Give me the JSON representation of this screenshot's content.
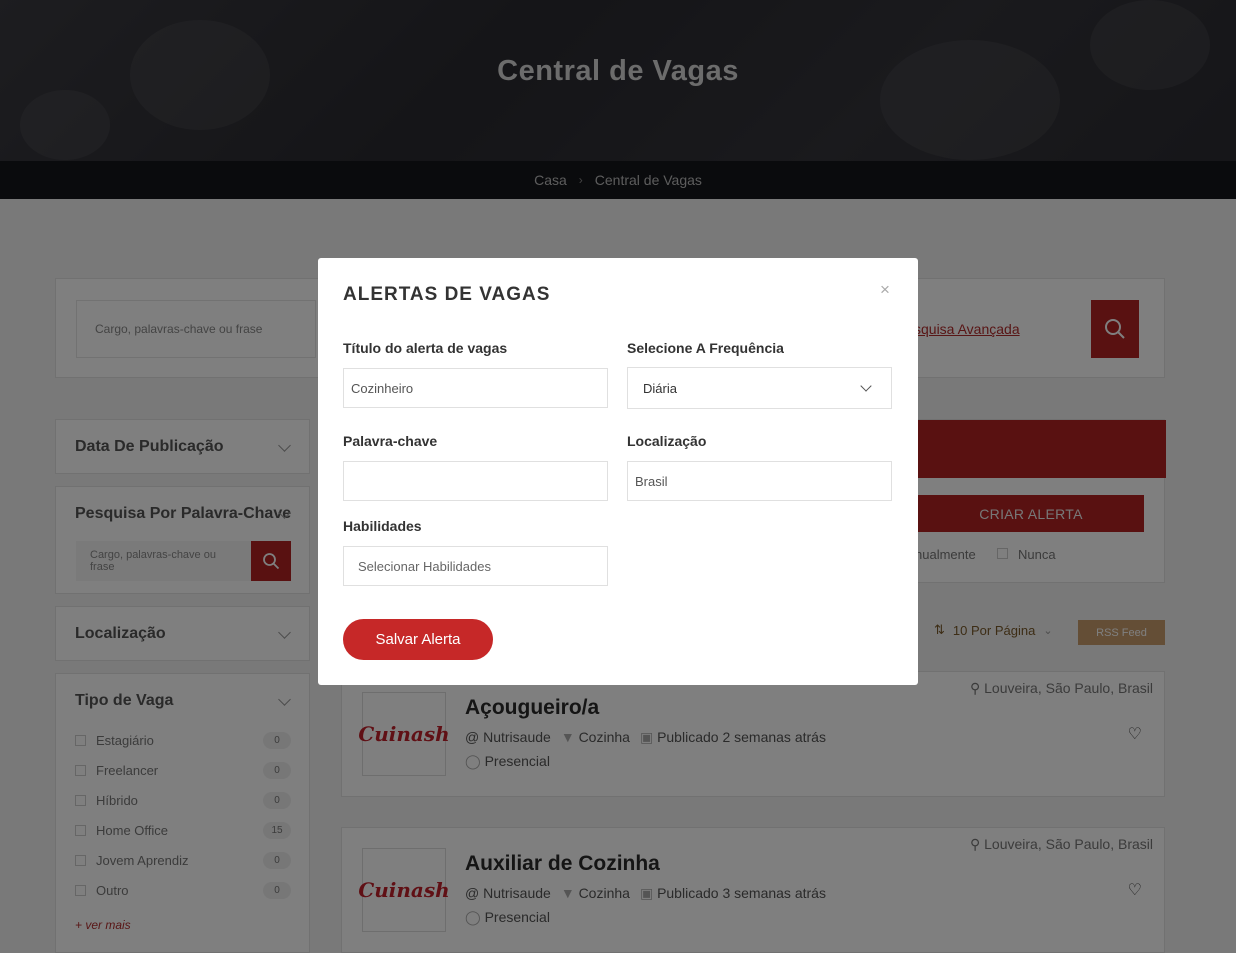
{
  "hero": {
    "title": "Central de Vagas"
  },
  "breadcrumb": {
    "items": [
      "Casa",
      "Central de Vagas"
    ]
  },
  "search": {
    "placeholder": "Cargo, palavras-chave ou frase",
    "advanced_link": "squisa Avançada"
  },
  "filters": {
    "date_title": "Data De Publicação",
    "keyword_title": "Pesquisa Por Palavra-Chave",
    "keyword_placeholder": "Cargo, palavras-chave ou frase",
    "location_title": "Localização",
    "type_title": "Tipo de Vaga",
    "types": [
      {
        "label": "Estagiário",
        "count": "0"
      },
      {
        "label": "Freelancer",
        "count": "0"
      },
      {
        "label": "Híbrido",
        "count": "0"
      },
      {
        "label": "Home Office",
        "count": "15"
      },
      {
        "label": "Jovem Aprendiz",
        "count": "0"
      },
      {
        "label": "Outro",
        "count": "0"
      }
    ],
    "see_more": "+ ver mais"
  },
  "alert_panel": {
    "create_label": "CRIAR ALERTA",
    "freq_1": "nualmente",
    "freq_2": "Nunca"
  },
  "listing": {
    "per_page": "10 Por Página",
    "rss": "RSS Feed"
  },
  "jobs": [
    {
      "title": "Açougueiro/a",
      "company": "@ Nutrisaude",
      "category": "Cozinha",
      "posted": "Publicado 2 semanas atrás",
      "mode": "Presencial",
      "location": "Louveira, São Paulo, Brasil",
      "logo": "Cuinash"
    },
    {
      "title": "Auxiliar de Cozinha",
      "company": "@ Nutrisaude",
      "category": "Cozinha",
      "posted": "Publicado 3 semanas atrás",
      "mode": "Presencial",
      "location": "Louveira, São Paulo, Brasil",
      "logo": "Cuinash"
    }
  ],
  "modal": {
    "title": "ALERTAS DE VAGAS",
    "close": "×",
    "alert_title_label": "Título do alerta de vagas",
    "alert_title_value": "Cozinheiro",
    "frequency_label": "Selecione A Frequência",
    "frequency_value": "Diária",
    "keyword_label": "Palavra-chave",
    "keyword_value": "",
    "location_label": "Localização",
    "location_value": "Brasil",
    "skills_label": "Habilidades",
    "skills_placeholder": "Selecionar Habilidades",
    "save_label": "Salvar Alerta"
  }
}
